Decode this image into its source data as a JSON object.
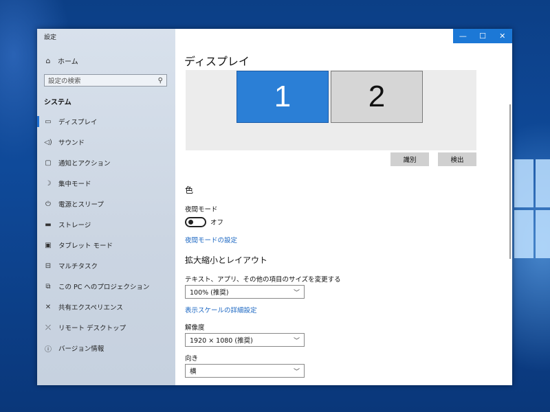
{
  "window": {
    "title": "設定",
    "controls": {
      "minimize": "—",
      "maximize": "☐",
      "close": "✕"
    }
  },
  "sidebar": {
    "home": {
      "label": "ホーム",
      "icon": "home-icon"
    },
    "search": {
      "placeholder": "設定の検索",
      "icon": "search-icon"
    },
    "section_title": "システム",
    "items": [
      {
        "label": "ディスプレイ",
        "icon": "monitor-icon",
        "active": true
      },
      {
        "label": "サウンド",
        "icon": "speaker-icon"
      },
      {
        "label": "通知とアクション",
        "icon": "notification-icon"
      },
      {
        "label": "集中モード",
        "icon": "moon-icon"
      },
      {
        "label": "電源とスリープ",
        "icon": "power-icon"
      },
      {
        "label": "ストレージ",
        "icon": "storage-icon"
      },
      {
        "label": "タブレット モード",
        "icon": "tablet-icon"
      },
      {
        "label": "マルチタスク",
        "icon": "multitask-icon"
      },
      {
        "label": "この PC へのプロジェクション",
        "icon": "projection-icon"
      },
      {
        "label": "共有エクスペリエンス",
        "icon": "shared-experience-icon"
      },
      {
        "label": "リモート デスクトップ",
        "icon": "remote-desktop-icon"
      },
      {
        "label": "バージョン情報",
        "icon": "info-icon"
      }
    ]
  },
  "main": {
    "title": "ディスプレイ",
    "monitors": {
      "one": "1",
      "two": "2"
    },
    "identify_button": "識別",
    "detect_button": "検出",
    "color_heading": "色",
    "night_light_label": "夜間モード",
    "night_light_state": "オフ",
    "night_light_link": "夜間モードの設定",
    "scale_heading": "拡大縮小とレイアウト",
    "scale_label": "テキスト、アプリ、その他の項目のサイズを変更する",
    "scale_value": "100% (推奨)",
    "advanced_scale_link": "表示スケールの詳細設定",
    "resolution_label": "解像度",
    "resolution_value": "1920 × 1080 (推奨)",
    "orientation_label": "向き",
    "orientation_value": "横"
  },
  "colors": {
    "accent": "#1c78d6",
    "link": "#1a66c2",
    "monitor_selected": "#2b7fd6"
  }
}
